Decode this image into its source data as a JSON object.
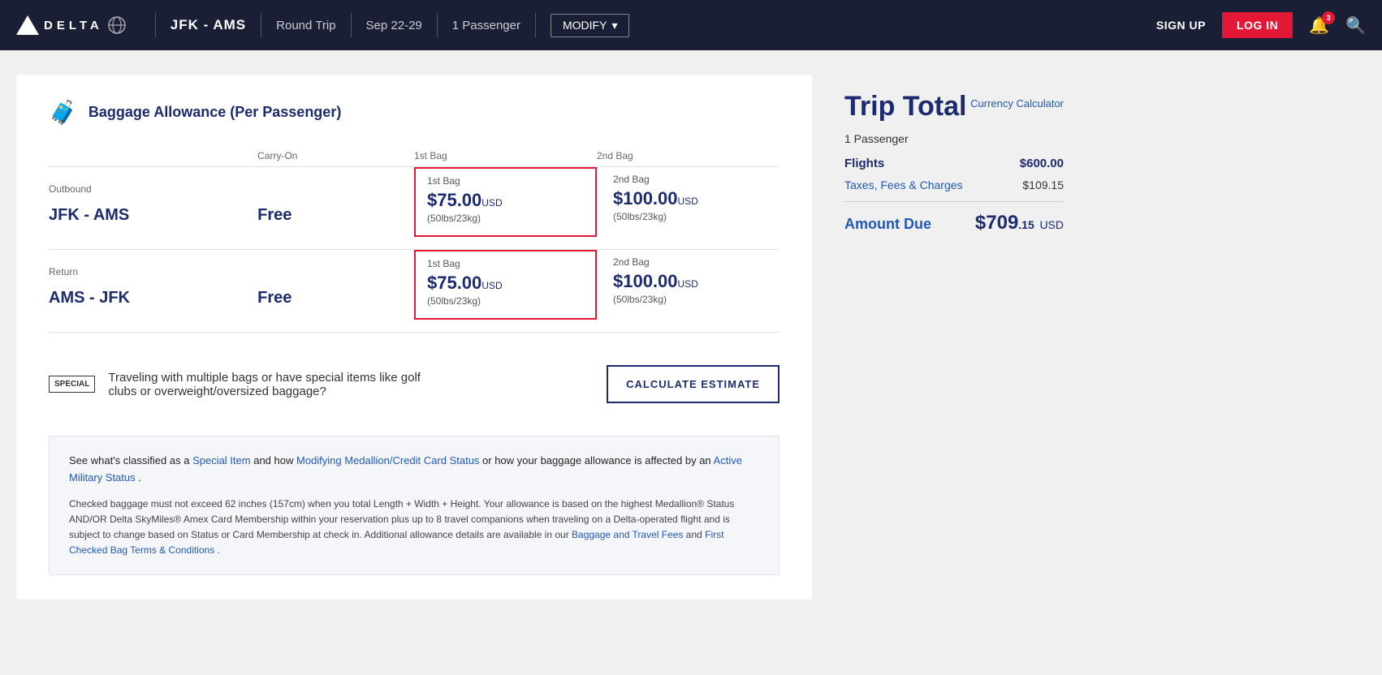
{
  "header": {
    "logo_text": "DELTA",
    "route": "JFK - AMS",
    "trip_type": "Round Trip",
    "dates": "Sep 22-29",
    "passengers": "1 Passenger",
    "modify_label": "MODIFY",
    "signup_label": "SIGN UP",
    "login_label": "LOG IN",
    "bell_count": "3"
  },
  "baggage": {
    "title": "Baggage Allowance (Per Passenger)",
    "headers": {
      "col1": "",
      "col2": "Carry-On",
      "col3": "1st Bag",
      "col4": "2nd Bag"
    },
    "outbound_label": "Outbound",
    "outbound_route": "JFK - AMS",
    "outbound_carryon": "Free",
    "outbound_bag1_label": "1st Bag",
    "outbound_bag1_price": "$75.00",
    "outbound_bag1_usd": "USD",
    "outbound_bag1_weight": "(50lbs/23kg)",
    "outbound_bag2_label": "2nd Bag",
    "outbound_bag2_price": "$100.00",
    "outbound_bag2_usd": "USD",
    "outbound_bag2_weight": "(50lbs/23kg)",
    "return_label": "Return",
    "return_route": "AMS - JFK",
    "return_carryon": "Free",
    "return_bag1_label": "1st Bag",
    "return_bag1_price": "$75.00",
    "return_bag1_usd": "USD",
    "return_bag1_weight": "(50lbs/23kg)",
    "return_bag2_label": "2nd Bag",
    "return_bag2_price": "$100.00",
    "return_bag2_usd": "USD",
    "return_bag2_weight": "(50lbs/23kg)"
  },
  "estimate": {
    "special_icon_label": "SPECIAL",
    "text": "Traveling with multiple bags or have special items like golf clubs or overweight/oversized baggage?",
    "button_label": "CALCULATE ESTIMATE"
  },
  "info": {
    "main_text_before": "See what's classified as a ",
    "special_item_link": "Special Item",
    "main_text_mid": " and how ",
    "medallion_link": "Modifying Medallion/Credit Card Status",
    "main_text_mid2": " or how your baggage allowance is affected by an ",
    "military_link": "Active Military Status",
    "main_text_end": " .",
    "detail": "Checked baggage must not exceed 62 inches (157cm) when you total Length + Width + Height. Your allowance is based on the highest Medallion® Status AND/OR Delta SkyMiles® Amex Card Membership within your reservation plus up to 8 travel companions when traveling on a Delta-operated flight and is subject to change based on Status or Card Membership at check in. Additional allowance details are available in our ",
    "baggage_fees_link": "Baggage and Travel Fees",
    "detail_mid": " and ",
    "first_bag_link": "First Checked Bag Terms & Conditions",
    "detail_end": " ."
  },
  "trip_total": {
    "title": "Trip Total",
    "currency_calc_label": "Currency Calculator",
    "passengers": "1 Passenger",
    "flights_label": "Flights",
    "flights_amount": "$600.00",
    "taxes_label": "Taxes, Fees & Charges",
    "taxes_amount": "$109.15",
    "amount_due_label": "Amount Due",
    "amount_due_dollars": "$709",
    "amount_due_cents": ".15",
    "amount_due_usd": "USD"
  }
}
